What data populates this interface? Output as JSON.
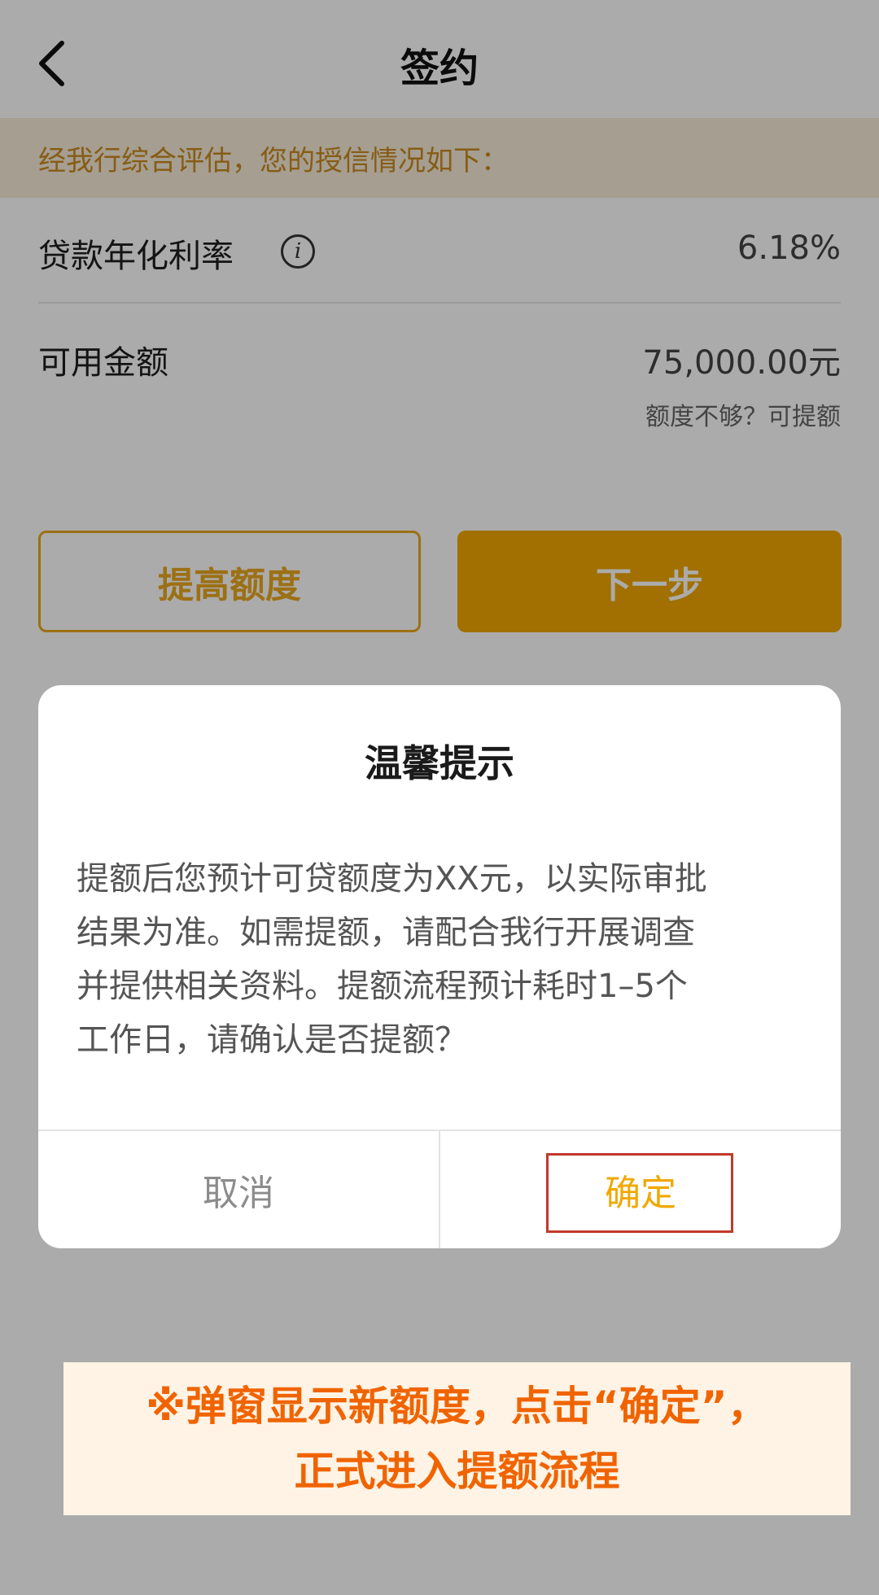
{
  "header": {
    "title": "签约",
    "back_icon": "chevron-left-icon"
  },
  "notice": {
    "text": "经我行综合评估，您的授信情况如下："
  },
  "info": {
    "rate_label": "贷款年化利率",
    "rate_icon": "info-icon",
    "rate_value": "6.18%",
    "amount_label": "可用金额",
    "amount_value": "75,000.00元",
    "raise_link": "额度不够？可提额"
  },
  "actions": {
    "raise_label": "提高额度",
    "next_label": "下一步"
  },
  "dialog": {
    "title": "温馨提示",
    "body_lines": [
      "提额后您预计可贷额度为XX元，以实际审批",
      "结果为准。如需提额，请配合我行开展调查",
      "并提供相关资料。提额流程预计耗时1–5个",
      "工作日，请确认是否提额？"
    ],
    "cancel_label": "取消",
    "confirm_label": "确定"
  },
  "annotation": {
    "line1": "※弹窗显示新额度，点击“确定”，",
    "line2": "正式进入提额流程"
  },
  "colors": {
    "accent": "#f0a800",
    "notice_bg": "#f7ecd9",
    "notice_text": "#c98a1e",
    "annotation_text": "#f06400",
    "highlight_border": "#c0392b"
  }
}
